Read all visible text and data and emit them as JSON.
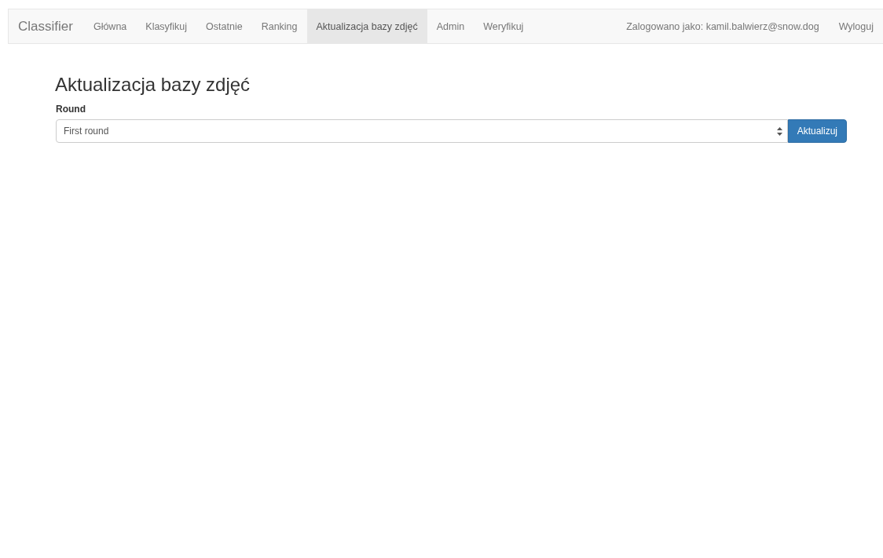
{
  "navbar": {
    "brand": "Classifier",
    "items": [
      {
        "label": "Główna",
        "selected": false
      },
      {
        "label": "Klasyfikuj",
        "selected": false
      },
      {
        "label": "Ostatnie",
        "selected": false
      },
      {
        "label": "Ranking",
        "selected": false
      },
      {
        "label": "Aktualizacja bazy zdjęć",
        "selected": true
      },
      {
        "label": "Admin",
        "selected": false
      },
      {
        "label": "Weryfikuj",
        "selected": false
      }
    ],
    "user_text": "Zalogowano jako: kamil.balwierz@snow.dog",
    "logout": "Wyloguj"
  },
  "page": {
    "title": "Aktualizacja bazy zdjęć",
    "field_label": "Round",
    "select_value": "First round",
    "button": "Aktualizuj"
  }
}
